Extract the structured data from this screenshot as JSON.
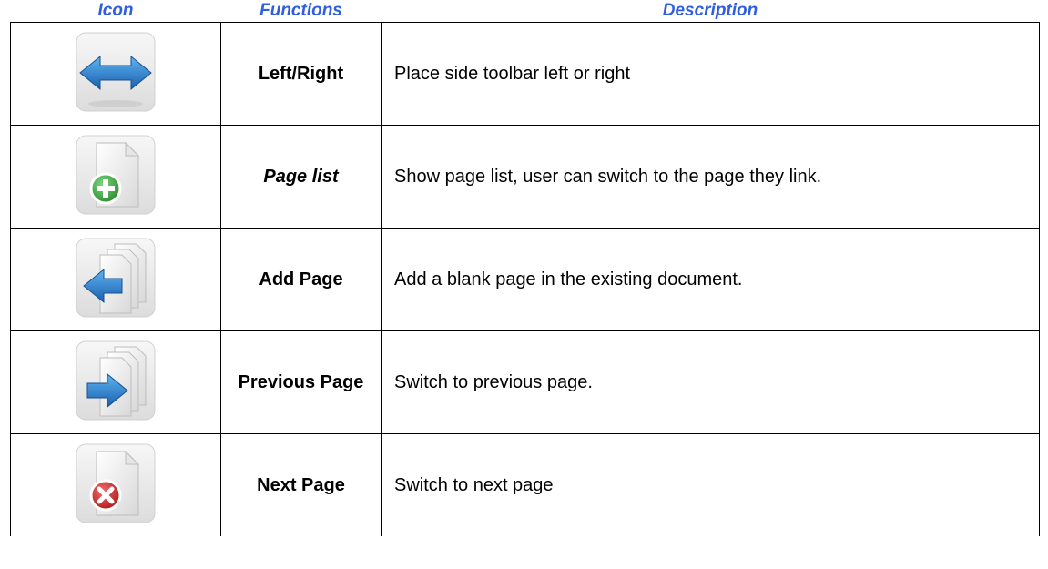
{
  "header": {
    "icon": "Icon",
    "functions": "Functions",
    "description": "Description"
  },
  "rows": [
    {
      "icon": "left-right-arrow-icon",
      "function": "Left/Right",
      "description": "Place side toolbar left or  right"
    },
    {
      "icon": "page-add-icon",
      "function": "Page list",
      "description": "Show page list, user can switch to the page they link."
    },
    {
      "icon": "pages-left-arrow-icon",
      "function": "Add Page",
      "description": "Add a blank page in the existing document."
    },
    {
      "icon": "pages-right-arrow-icon",
      "function": "Previous Page",
      "description": "Switch to previous page."
    },
    {
      "icon": "page-delete-icon",
      "function": "Next Page",
      "description": "Switch to next page"
    }
  ],
  "colors": {
    "header_text": "#2f5fe0",
    "arrow_blue": "#1f7fd6",
    "plus_green": "#3aa83a",
    "delete_red": "#d42a2a"
  }
}
